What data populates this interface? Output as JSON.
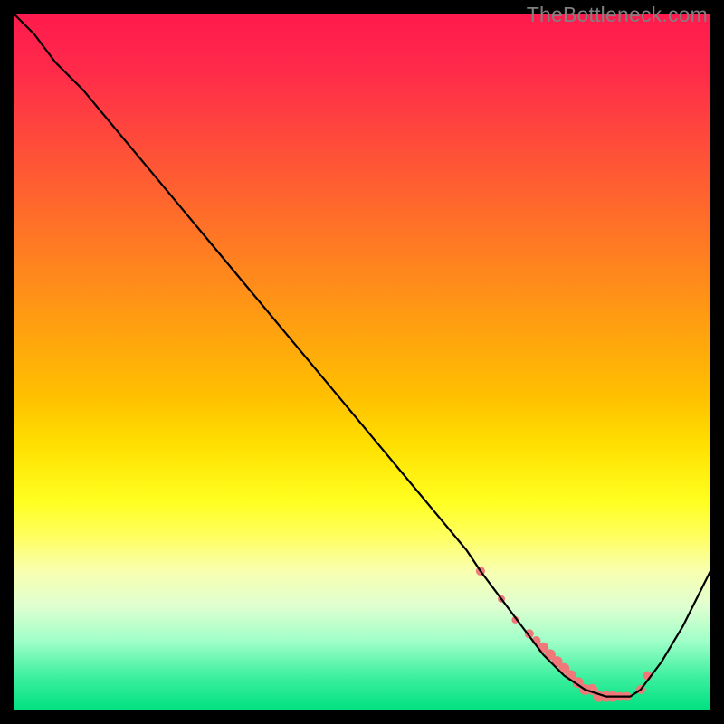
{
  "watermark": "TheBottleneck.com",
  "chart_data": {
    "type": "line",
    "title": "",
    "xlabel": "",
    "ylabel": "",
    "xlim": [
      0,
      100
    ],
    "ylim": [
      0,
      100
    ],
    "series": [
      {
        "name": "bottleneck-curve",
        "x": [
          0,
          3,
          6,
          10,
          15,
          20,
          25,
          30,
          35,
          40,
          45,
          50,
          55,
          60,
          65,
          67,
          70,
          73,
          76,
          79,
          82,
          85,
          87,
          88.5,
          90,
          93,
          96,
          100
        ],
        "y": [
          100,
          97,
          93,
          89,
          83,
          77,
          71,
          65,
          59,
          53,
          47,
          41,
          35,
          29,
          23,
          20,
          16,
          12,
          8,
          5,
          3,
          2,
          2,
          2,
          3,
          7,
          12,
          20
        ]
      }
    ],
    "markers": {
      "name": "highlight-cluster",
      "color": "#f07878",
      "x": [
        67,
        70,
        72,
        74,
        75,
        76,
        77,
        78,
        79,
        80,
        81,
        82,
        83,
        84,
        85,
        86,
        87,
        88,
        90,
        91
      ],
      "y": [
        20,
        16,
        13,
        11,
        10,
        9,
        8,
        7,
        6,
        5,
        4,
        3,
        3,
        2,
        2,
        2,
        2,
        2,
        3,
        5
      ],
      "r": [
        5,
        4,
        4,
        5,
        5,
        6,
        6,
        6,
        6,
        6,
        6,
        6,
        6,
        6,
        6,
        6,
        5,
        5,
        5,
        5
      ]
    }
  }
}
